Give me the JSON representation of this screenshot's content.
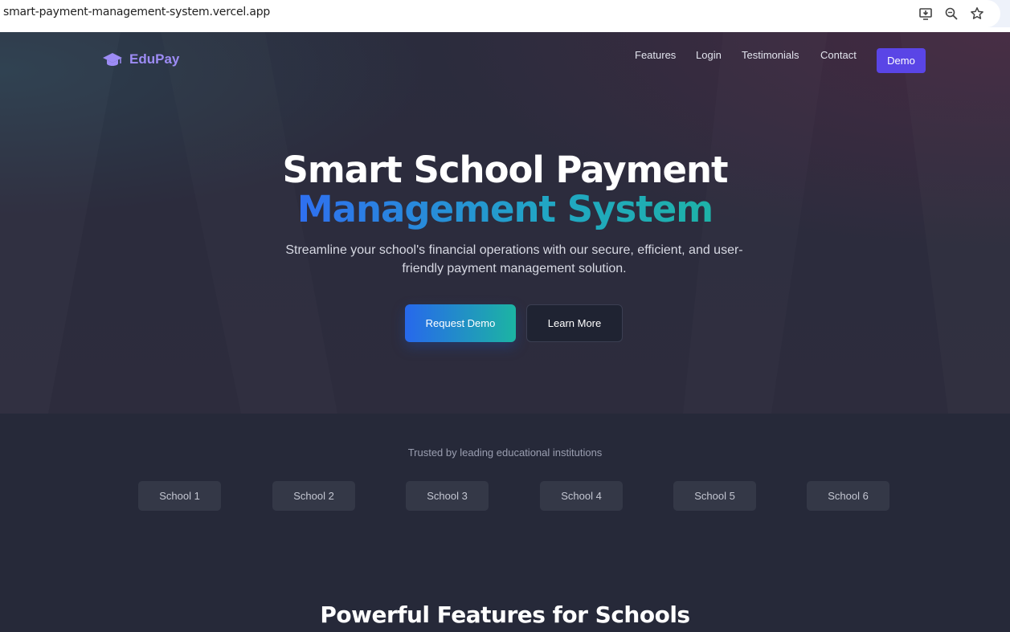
{
  "browser": {
    "url": "smart-payment-management-system.vercel.app",
    "icons": [
      "install-app-icon",
      "zoom-icon",
      "bookmark-star-icon"
    ]
  },
  "nav": {
    "logo": "EduPay",
    "links": [
      "Features",
      "Login",
      "Testimonials",
      "Contact"
    ],
    "demo_label": "Demo"
  },
  "hero": {
    "title_line1": "Smart School Payment",
    "title_line2": "Management System",
    "subtitle": "Streamline your school's financial operations with our secure, efficient, and user-friendly payment management solution.",
    "primary_button": "Request Demo",
    "secondary_button": "Learn More"
  },
  "trusted": {
    "label": "Trusted by leading educational institutions",
    "schools": [
      "School 1",
      "School 2",
      "School 3",
      "School 4",
      "School 5",
      "School 6"
    ]
  },
  "features": {
    "title": "Powerful Features for Schools"
  },
  "colors": {
    "accent": "#5a45e6",
    "gradient_start": "#2768ec",
    "gradient_end": "#1cb4a3",
    "logo": "#9d8cf5"
  }
}
